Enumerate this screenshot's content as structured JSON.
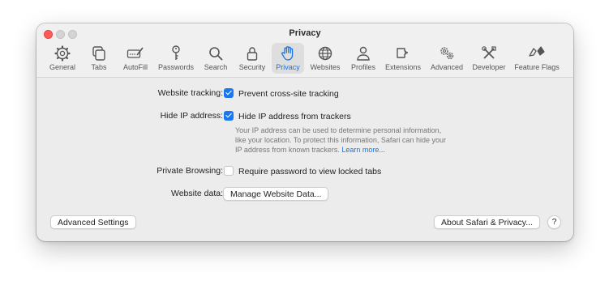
{
  "window": {
    "title": "Privacy"
  },
  "toolbar": {
    "items": [
      {
        "label": "General",
        "icon": "gear-icon"
      },
      {
        "label": "Tabs",
        "icon": "tabs-icon"
      },
      {
        "label": "AutoFill",
        "icon": "autofill-icon"
      },
      {
        "label": "Passwords",
        "icon": "key-icon"
      },
      {
        "label": "Search",
        "icon": "search-icon"
      },
      {
        "label": "Security",
        "icon": "lock-icon"
      },
      {
        "label": "Privacy",
        "icon": "hand-icon",
        "active": true
      },
      {
        "label": "Websites",
        "icon": "globe-icon"
      },
      {
        "label": "Profiles",
        "icon": "person-icon"
      },
      {
        "label": "Extensions",
        "icon": "puzzle-icon"
      },
      {
        "label": "Advanced",
        "icon": "gears-icon"
      },
      {
        "label": "Developer",
        "icon": "tools-icon"
      },
      {
        "label": "Feature Flags",
        "icon": "flags-icon"
      }
    ]
  },
  "privacy": {
    "website_tracking": {
      "label": "Website tracking:",
      "option": "Prevent cross-site tracking",
      "checked": true
    },
    "hide_ip": {
      "label": "Hide IP address:",
      "option": "Hide IP address from trackers",
      "checked": true,
      "description_line1": "Your IP address can be used to determine personal information,",
      "description_line2": "like your location. To protect this information, Safari can hide your",
      "description_line3": "IP address from known trackers.",
      "learn_more": "Learn more..."
    },
    "private_browsing": {
      "label": "Private Browsing:",
      "option": "Require password to view locked tabs",
      "checked": false
    },
    "website_data": {
      "label": "Website data:",
      "button": "Manage Website Data..."
    }
  },
  "footer": {
    "advanced_settings": "Advanced Settings",
    "about": "About Safari & Privacy...",
    "help": "?"
  },
  "colors": {
    "accent": "#1877f2",
    "close": "#ff5f57",
    "window_bg": "#ececec"
  }
}
